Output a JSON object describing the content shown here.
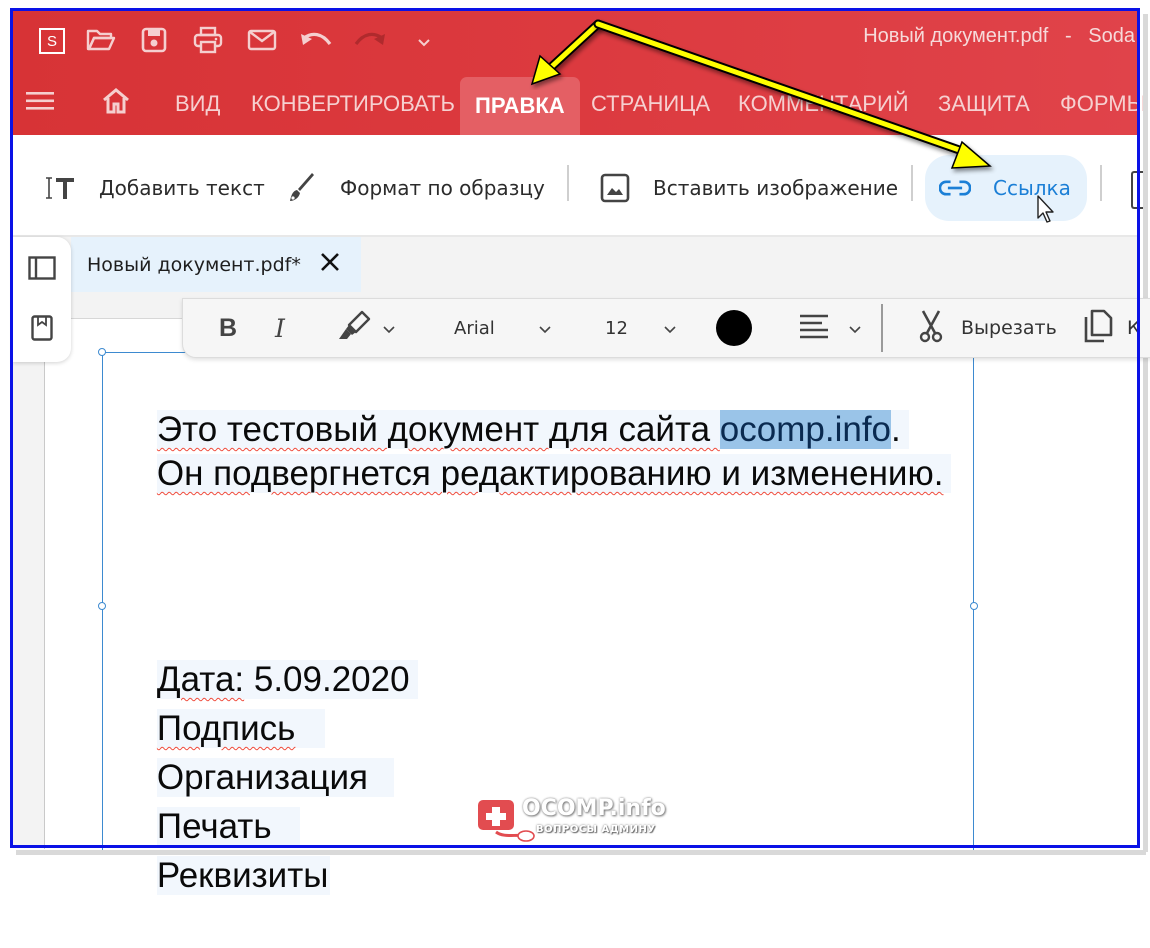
{
  "window": {
    "title": "Новый документ.pdf   -   Soda",
    "app_logo_letter": "S"
  },
  "quick_access": [
    {
      "icon": "folder-open-icon"
    },
    {
      "icon": "save-icon"
    },
    {
      "icon": "print-icon"
    },
    {
      "icon": "mail-icon"
    },
    {
      "icon": "undo-icon"
    },
    {
      "icon": "redo-icon"
    },
    {
      "icon": "chevron-down-icon"
    }
  ],
  "menu": {
    "hamburger_icon": "menu-icon",
    "home_icon": "home-icon",
    "tabs": [
      {
        "label": "ВИД",
        "active": false
      },
      {
        "label": "КОНВЕРТИРОВАТЬ",
        "active": false
      },
      {
        "label": "ПРАВКА",
        "active": true
      },
      {
        "label": "СТРАНИЦА",
        "active": false
      },
      {
        "label": "КОММЕНТАРИЙ",
        "active": false
      },
      {
        "label": "ЗАЩИТА",
        "active": false
      },
      {
        "label": "ФОРМЫ",
        "active": false
      }
    ]
  },
  "ribbon": {
    "add_text": "Добавить текст",
    "format_painter": "Формат по образцу",
    "insert_image": "Вставить изображение",
    "link": "Ссылка",
    "link_color": "#1b7fd6"
  },
  "document_tab": {
    "name": "Новый документ.pdf*"
  },
  "format_toolbar": {
    "bold": "B",
    "italic": "I",
    "font": "Arial",
    "size": "12",
    "color": "#000000",
    "cut": "Вырезать",
    "copy_partial": "К"
  },
  "document": {
    "line1_before": "Это тестовый документ для сайта ",
    "line1_selected": "ocomp.info",
    "line1_after": ".",
    "line2": "Он подвергнется редактированию и изменению.",
    "date_label": "Дата:",
    "date_value": " 5.09.2020",
    "signature": "Подпись",
    "organization": "Организация",
    "stamp": "Печать",
    "requisites": "Реквизиты"
  },
  "watermark": {
    "brand": "OCOMP.info",
    "tagline": "ВОПРОСЫ АДМИНУ"
  },
  "annotation": {
    "arrow_color": "#ffff00"
  }
}
